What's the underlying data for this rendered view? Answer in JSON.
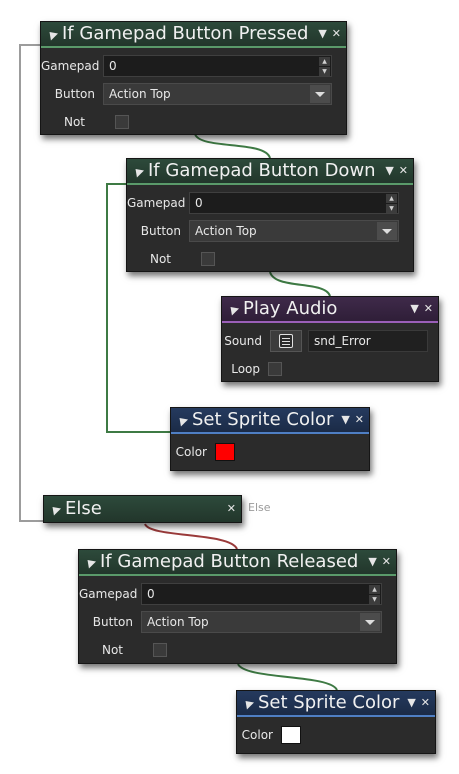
{
  "nodes": {
    "pressed": {
      "title": "If Gamepad Button Pressed",
      "gamepad_label": "Gamepad",
      "gamepad_value": "0",
      "button_label": "Button",
      "button_value": "Action Top",
      "not_label": "Not"
    },
    "down": {
      "title": "If Gamepad Button Down",
      "gamepad_label": "Gamepad",
      "gamepad_value": "0",
      "button_label": "Button",
      "button_value": "Action Top",
      "not_label": "Not"
    },
    "play_audio": {
      "title": "Play Audio",
      "sound_label": "Sound",
      "sound_value": "snd_Error",
      "loop_label": "Loop"
    },
    "sprite_color_1": {
      "title": "Set Sprite Color",
      "color_label": "Color",
      "color_value": "#ff0000"
    },
    "else": {
      "title": "Else",
      "ghost_label": "Else"
    },
    "released": {
      "title": "If Gamepad Button Released",
      "gamepad_label": "Gamepad",
      "gamepad_value": "0",
      "button_label": "Button",
      "button_value": "Action Top",
      "not_label": "Not"
    },
    "sprite_color_2": {
      "title": "Set Sprite Color",
      "color_label": "Color",
      "color_value": "#ffffff"
    }
  },
  "icons": {
    "collapse": "collapse-triangle-icon",
    "menu": "dropdown-menu-icon",
    "close": "close-icon",
    "asset": "asset-browser-icon"
  },
  "colors": {
    "condition_header": "#2d4a3b",
    "audio_header": "#3f2a4a",
    "sprite_header": "#253a5e",
    "node_body": "#2b2b2b"
  }
}
